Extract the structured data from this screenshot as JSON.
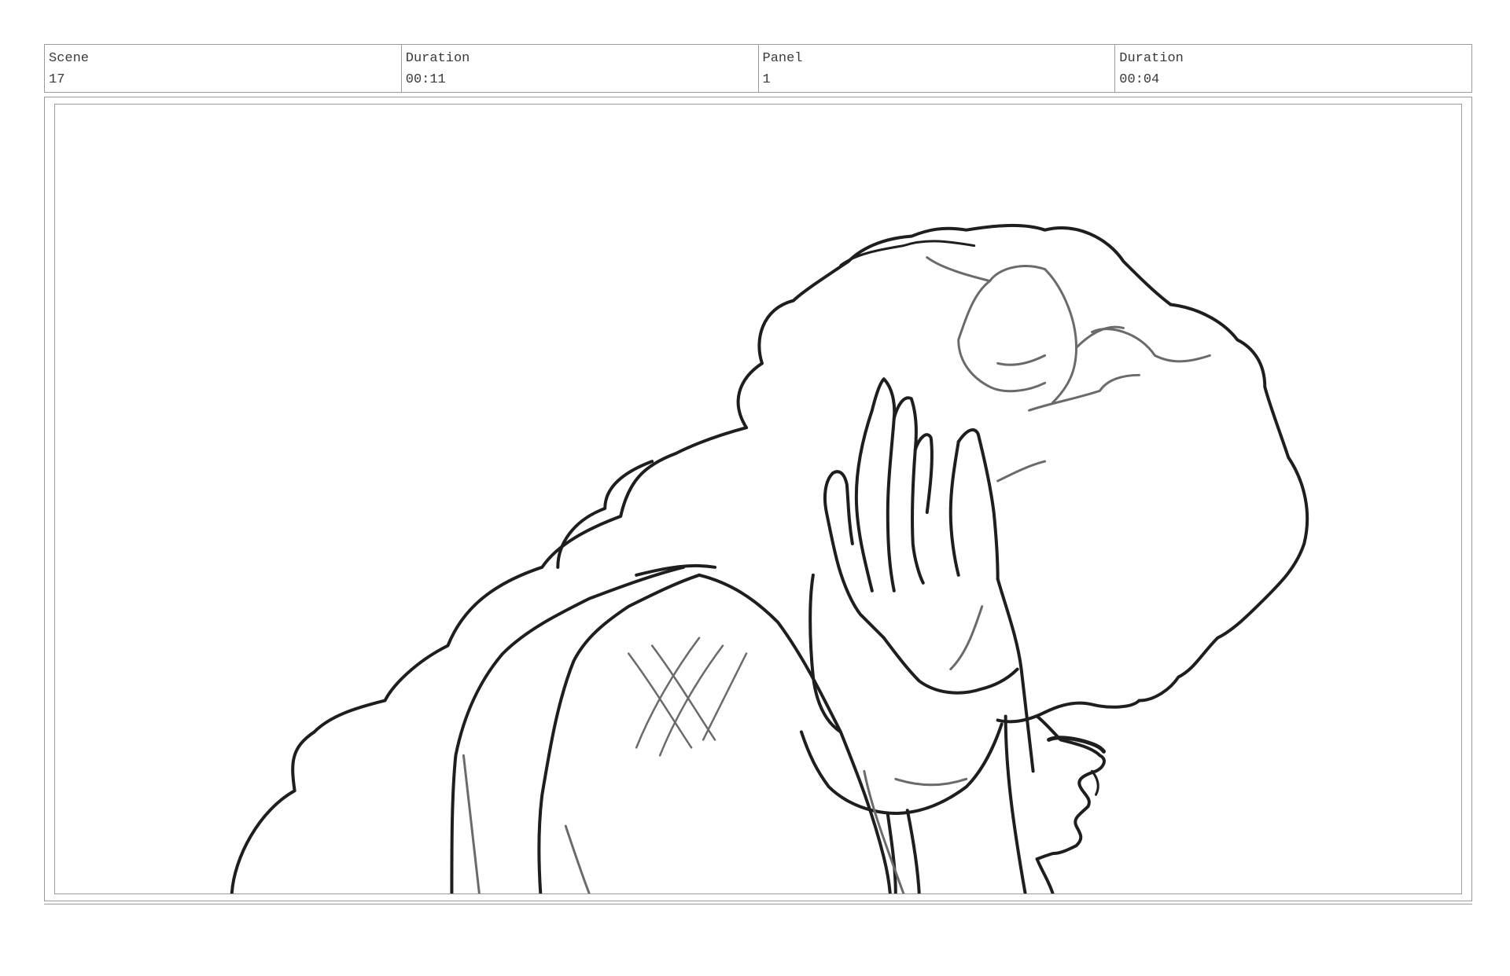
{
  "header": {
    "scene_label": "Scene",
    "scene_value": "17",
    "scene_duration_label": "Duration",
    "scene_duration_value": "00:11",
    "panel_label": "Panel",
    "panel_value": "1",
    "panel_duration_label": "Duration",
    "panel_duration_value": "00:04"
  },
  "panel": {
    "drawing": "sketch-figure"
  }
}
